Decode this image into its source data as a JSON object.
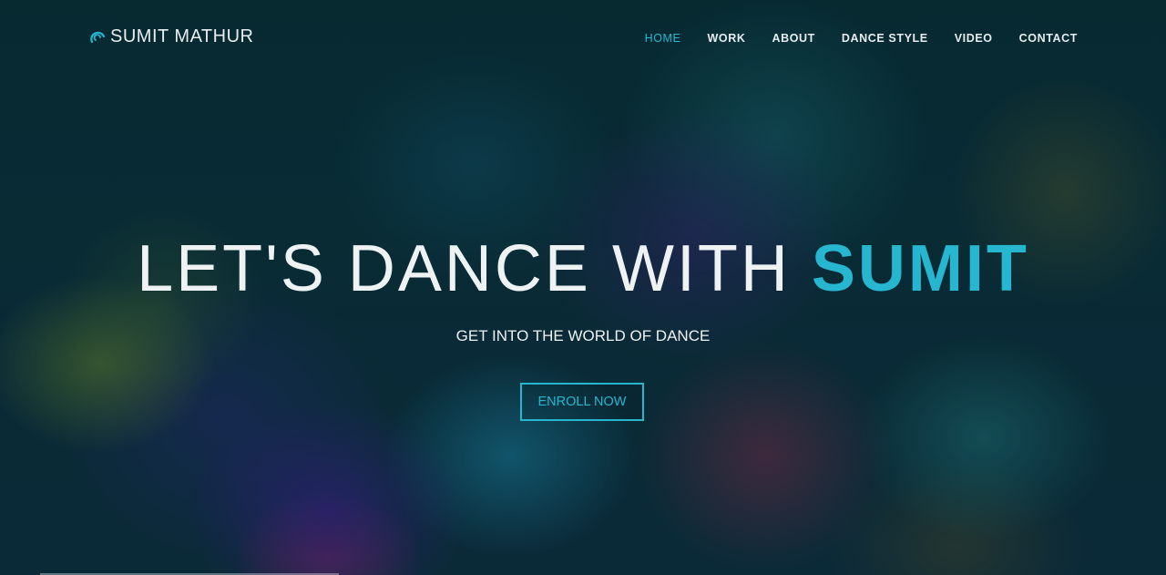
{
  "brand": {
    "name": "SUMIT MATHUR",
    "icon": "swirl-logo-icon"
  },
  "nav": {
    "items": [
      {
        "label": "HOME",
        "active": true
      },
      {
        "label": "WORK",
        "active": false
      },
      {
        "label": "ABOUT",
        "active": false
      },
      {
        "label": "DANCE STYLE",
        "active": false
      },
      {
        "label": "VIDEO",
        "active": false
      },
      {
        "label": "CONTACT",
        "active": false
      }
    ]
  },
  "hero": {
    "headline_main": "LET'S DANCE WITH ",
    "headline_accent": "SUMIT",
    "subtitle": "GET INTO THE WORLD OF DANCE",
    "cta_label": "ENROLL NOW"
  },
  "colors": {
    "accent": "#27b6d0",
    "background": "#06262e",
    "text": "#eef2f3"
  }
}
